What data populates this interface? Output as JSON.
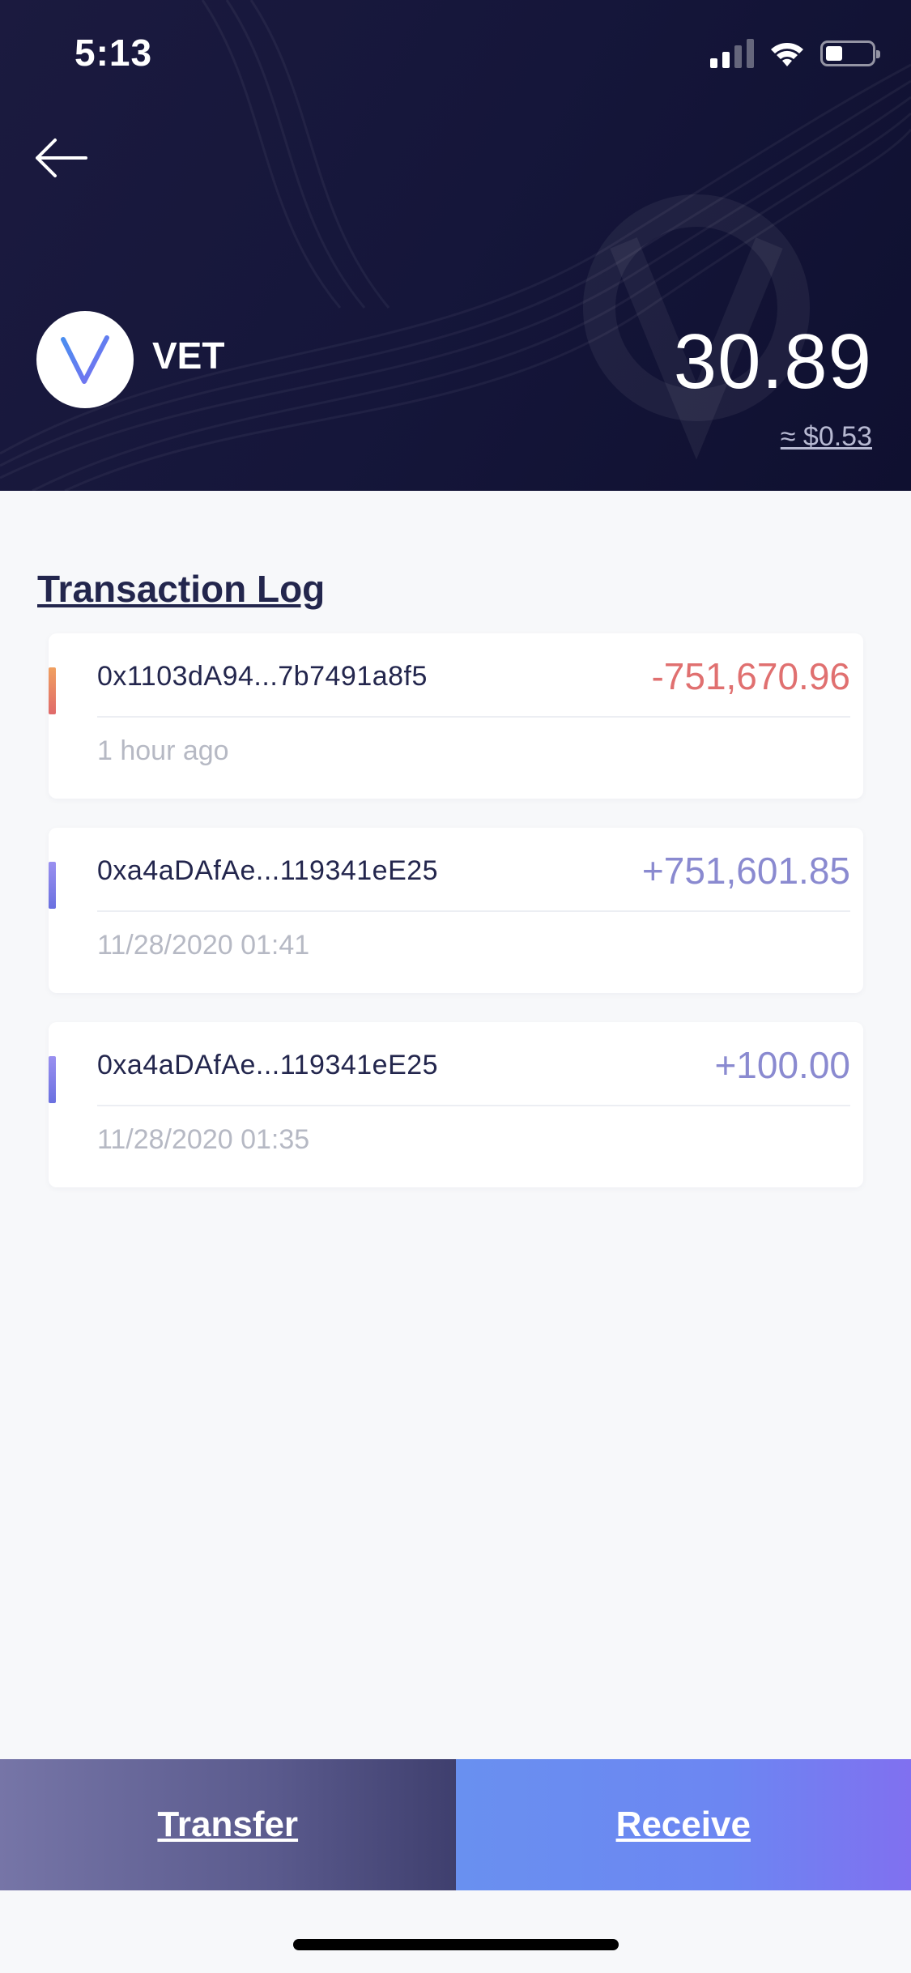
{
  "status_bar": {
    "time": "5:13",
    "signal_icon": "signal-icon",
    "wifi_icon": "wifi-icon",
    "battery_icon": "battery-icon"
  },
  "header": {
    "back_icon": "arrow-left-icon",
    "coin": {
      "symbol": "VET",
      "logo_icon": "vechain-logo-icon",
      "balance": "30.89",
      "fiat_value": "≈ $0.53"
    }
  },
  "transactions": {
    "title": "Transaction Log",
    "items": [
      {
        "address": "0x1103dA94...7b7491a8f5",
        "amount": "-751,670.96",
        "time": "1 hour ago",
        "direction": "out",
        "color": "#e07070"
      },
      {
        "address": "0xa4aDAfAe...119341eE25",
        "amount": "+751,601.85",
        "time": "11/28/2020 01:41",
        "direction": "in",
        "color": "#8a8ad0"
      },
      {
        "address": "0xa4aDAfAe...119341eE25",
        "amount": "+100.00",
        "time": "11/28/2020 01:35",
        "direction": "in",
        "color": "#8a8ad0"
      }
    ]
  },
  "actions": {
    "transfer_label": "Transfer",
    "receive_label": "Receive"
  },
  "colors": {
    "header_bg": "#15163a",
    "outgoing": "#e07070",
    "incoming": "#8a8ad0",
    "transfer_btn": "#5a5a8d",
    "receive_btn": "#6c86f2"
  }
}
